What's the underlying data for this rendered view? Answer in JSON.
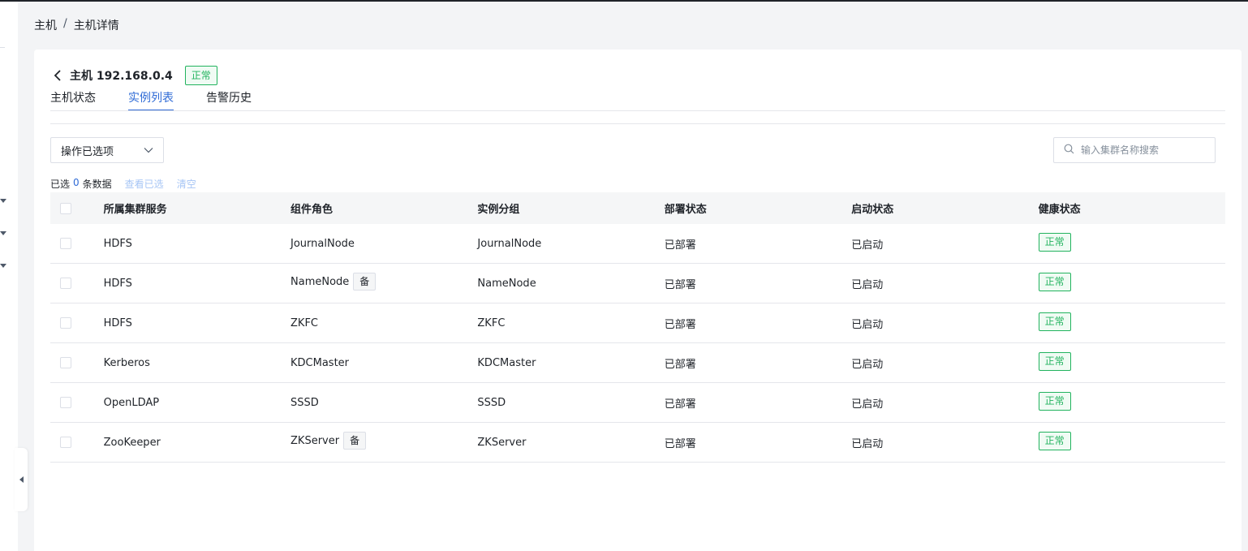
{
  "breadcrumb": {
    "root": "主机",
    "separator": "/",
    "current": "主机详情"
  },
  "host": {
    "title": "主机 192.168.0.4",
    "status": "正常"
  },
  "tabs": [
    {
      "label": "主机状态",
      "active": false
    },
    {
      "label": "实例列表",
      "active": true
    },
    {
      "label": "告警历史",
      "active": false
    }
  ],
  "toolbar": {
    "operation_select": "操作已选项",
    "search_placeholder": "输入集群名称搜索"
  },
  "selection": {
    "prefix": "已选",
    "count": "0",
    "suffix": "条数据",
    "view_selected": "查看已选",
    "clear": "清空"
  },
  "table": {
    "columns": [
      "所属集群服务",
      "组件角色",
      "实例分组",
      "部署状态",
      "启动状态",
      "健康状态"
    ],
    "rows": [
      {
        "service": "HDFS",
        "role": "JournalNode",
        "role_tag": "",
        "group": "JournalNode",
        "deploy": "已部署",
        "start": "已启动",
        "health": "正常"
      },
      {
        "service": "HDFS",
        "role": "NameNode",
        "role_tag": "备",
        "group": "NameNode",
        "deploy": "已部署",
        "start": "已启动",
        "health": "正常"
      },
      {
        "service": "HDFS",
        "role": "ZKFC",
        "role_tag": "",
        "group": "ZKFC",
        "deploy": "已部署",
        "start": "已启动",
        "health": "正常"
      },
      {
        "service": "Kerberos",
        "role": "KDCMaster",
        "role_tag": "",
        "group": "KDCMaster",
        "deploy": "已部署",
        "start": "已启动",
        "health": "正常"
      },
      {
        "service": "OpenLDAP",
        "role": "SSSD",
        "role_tag": "",
        "group": "SSSD",
        "deploy": "已部署",
        "start": "已启动",
        "health": "正常"
      },
      {
        "service": "ZooKeeper",
        "role": "ZKServer",
        "role_tag": "备",
        "group": "ZKServer",
        "deploy": "已部署",
        "start": "已启动",
        "health": "正常"
      }
    ]
  },
  "colors": {
    "accent": "#2f6bd6",
    "success": "#22b35e",
    "border": "#e5e6eb"
  },
  "icons": {
    "back": "chevron-left-icon",
    "select": "chevron-down-icon",
    "search": "search-icon",
    "collapse": "caret-left-icon"
  }
}
